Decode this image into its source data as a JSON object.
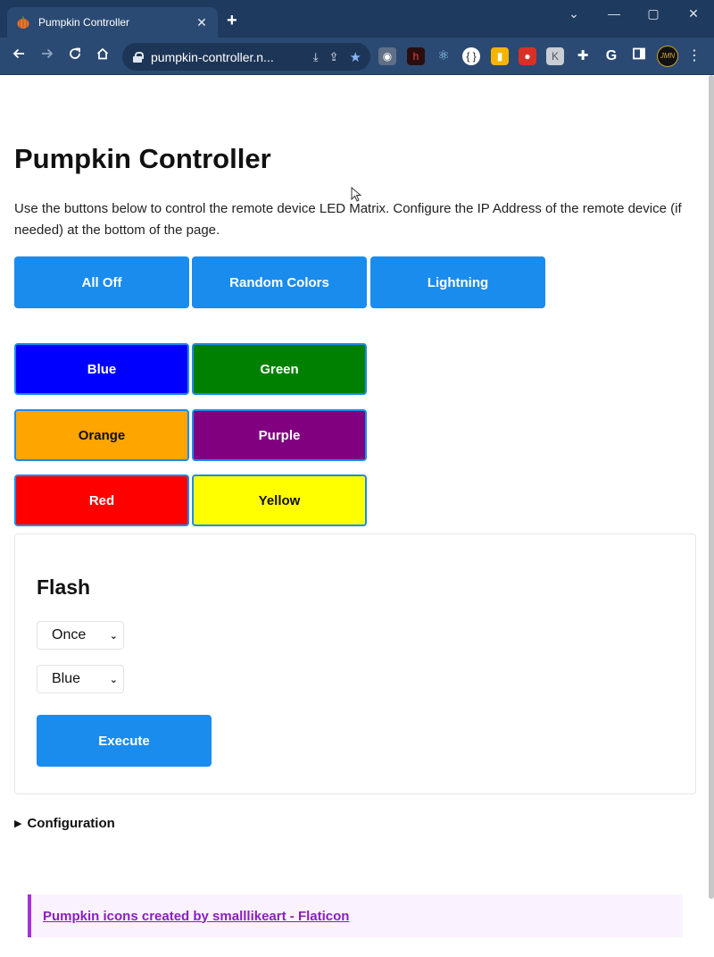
{
  "browser": {
    "tab_title": "Pumpkin Controller",
    "tab_close": "✕",
    "new_tab": "+",
    "url": "pumpkin-controller.n...",
    "win_min": "—",
    "win_max": "▢",
    "win_close": "✕",
    "win_dropdown": "⌄",
    "icons": {
      "back": "back-arrow-icon",
      "forward": "forward-arrow-icon",
      "reload": "reload-icon",
      "home": "home-icon",
      "lock": "lock-icon",
      "install": "install-icon",
      "share": "share-icon",
      "bookmark": "star-icon",
      "extensions": "puzzle-icon",
      "sidepanel": "side-panel-icon",
      "menu": "kebab-menu-icon"
    },
    "profile_initials": "JMN"
  },
  "page": {
    "title": "Pumpkin Controller",
    "intro": "Use the buttons below to control the remote device LED Matrix. Configure the IP Address of the remote device (if needed) at the bottom of the page.",
    "actions": [
      "All Off",
      "Random Colors",
      "Lightning"
    ],
    "colors": [
      {
        "label": "Blue",
        "bg": "#0000ff",
        "fg": "#ffffff"
      },
      {
        "label": "Green",
        "bg": "#008000",
        "fg": "#ffffff"
      },
      {
        "label": "Orange",
        "bg": "#ffa500",
        "fg": "#111111"
      },
      {
        "label": "Purple",
        "bg": "#800080",
        "fg": "#ffffff"
      },
      {
        "label": "Red",
        "bg": "#ff0000",
        "fg": "#ffffff"
      },
      {
        "label": "Yellow",
        "bg": "#ffff00",
        "fg": "#111111"
      }
    ],
    "flash": {
      "heading": "Flash",
      "mode_value": "Once",
      "color_value": "Blue",
      "execute_label": "Execute"
    },
    "configuration_label": "Configuration",
    "credit_link": "Pumpkin icons created by smalllikeart - Flaticon"
  },
  "theme": {
    "primary": "#1a8cee",
    "credit_accent": "#a531d6"
  }
}
